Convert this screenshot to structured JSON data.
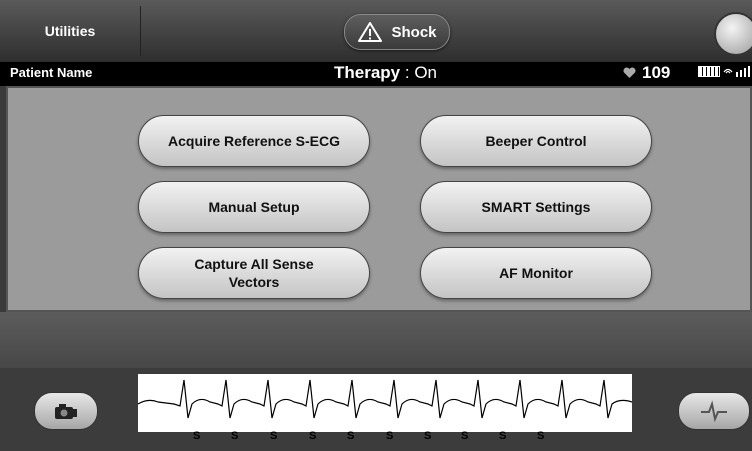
{
  "header": {
    "utilities_label": "Utilities",
    "shock_label": "Shock"
  },
  "status": {
    "patient_name": "Patient Name",
    "therapy_label": "Therapy",
    "therapy_sep": " : ",
    "therapy_value": "On",
    "heart_rate": "109"
  },
  "menu": {
    "items": [
      {
        "label": "Acquire Reference S-ECG"
      },
      {
        "label": "Beeper Control"
      },
      {
        "label": "Manual Setup"
      },
      {
        "label": "SMART Settings"
      },
      {
        "label": "Capture All Sense Vectors"
      },
      {
        "label": "AF Monitor"
      }
    ]
  },
  "ecg": {
    "sense_markers": [
      "S",
      "S",
      "S",
      "S",
      "S",
      "S",
      "S",
      "S",
      "S",
      "S"
    ]
  },
  "icons": {
    "warning": "warning-triangle-icon",
    "heart": "heart-icon",
    "battery": "battery-icon",
    "signal": "signal-icon",
    "camera": "camera-icon",
    "corner": "corner-logo-icon",
    "snapshot": "snapshot-icon"
  }
}
